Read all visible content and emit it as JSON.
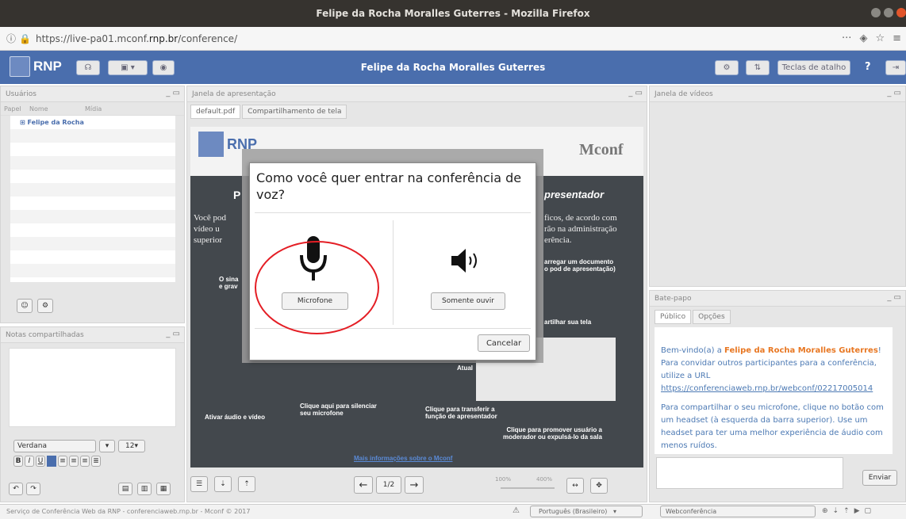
{
  "window": {
    "title": "Felipe da Rocha Moralles Guterres - Mozilla Firefox"
  },
  "browser": {
    "url_prefix": "https://live-pa01.mconf.",
    "url_domain": "rnp.br",
    "url_path": "/conference/",
    "more": "···"
  },
  "app": {
    "logo": "RNP",
    "title": "Felipe da Rocha Moralles Guterres",
    "shortcut_label": "Teclas de atalho",
    "help": "?"
  },
  "users": {
    "title": "Usuários",
    "columns": [
      "Papel",
      "Nome",
      "Mídia"
    ],
    "user": "Felipe da Rocha"
  },
  "notes": {
    "title": "Notas compartilhadas",
    "font": "Verdana",
    "size": "12"
  },
  "presentation": {
    "title": "Janela de apresentação",
    "tabs": [
      "default.pdf",
      "Compartilhamento de tela"
    ],
    "page": "1/2",
    "zoom_min": "100%",
    "zoom_max": "400%"
  },
  "slide": {
    "logo_left": "RNP",
    "heading_left": "P",
    "heading_right": "presentador",
    "text_left": "Você pod\nvídeo u\nsuperior",
    "text_right": "ficos, de acordo com\nrão na administração\nerência.",
    "bullet_right": "arregar um documento\no pod de apresentação)",
    "share": "artilhar sua tela",
    "mute_hint": "Clique aqui para silenciar\nseu microfone",
    "activate": "Ativar áudio e vídeo",
    "transfer": "Clique para transferir a\nfunção de apresentador",
    "promote": "Clique para promover usuário a\nmoderador ou expulsá-lo da sala",
    "more_info": "Mais informações sobre o Mconf",
    "logo_right": "Mconf",
    "atual": "Atual",
    "small_s": "O sina\ne grav"
  },
  "dialog": {
    "question": "Como você quer entrar na conferência de voz?",
    "mic": "Microfone",
    "listen": "Somente ouvir",
    "cancel": "Cancelar"
  },
  "video": {
    "title": "Janela de vídeos"
  },
  "chat": {
    "title": "Bate-papo",
    "tabs": [
      "Público",
      "Opções"
    ],
    "welcome_pre": "Bem-vindo(a) a ",
    "welcome_name": "Felipe da Rocha Moralles Guterres",
    "welcome_post": "!",
    "invite": "Para convidar outros participantes para a conferência, utilize a URL",
    "link": "https://conferenciaweb.rnp.br/webconf/02217005014",
    "mic_tip": "Para compartilhar o seu microfone, clique no botão com um headset (à esquerda da barra superior). Use um headset para ter uma melhor experiência de áudio com menos ruídos.",
    "send": "Enviar"
  },
  "status": {
    "footer": "Serviço de Conferência Web da RNP - conferenciaweb.rnp.br - Mconf © 2017",
    "language": "Português (Brasileiro)",
    "layout": "Webconferência"
  }
}
